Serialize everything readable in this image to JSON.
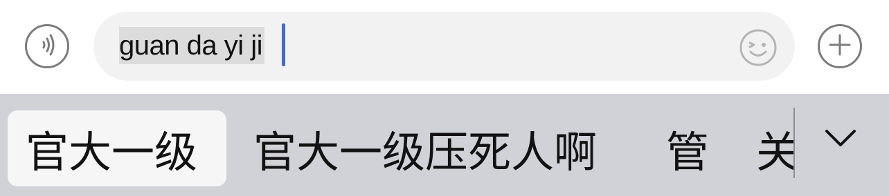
{
  "input_bar": {
    "voice_icon": "voice-waves-icon",
    "text_value": "guan da yi ji",
    "emoji_icon": "smiley-face-icon",
    "plus_icon": "plus-icon",
    "caret_color": "#3d68e8"
  },
  "candidates": {
    "items": [
      {
        "label": "官大一级",
        "selected": true
      },
      {
        "label": "官大一级压死人啊",
        "selected": false
      },
      {
        "label": "管",
        "selected": false
      },
      {
        "label": "关",
        "selected": false
      }
    ],
    "expand_icon": "chevron-down-icon",
    "background": "#d1d2d7"
  }
}
